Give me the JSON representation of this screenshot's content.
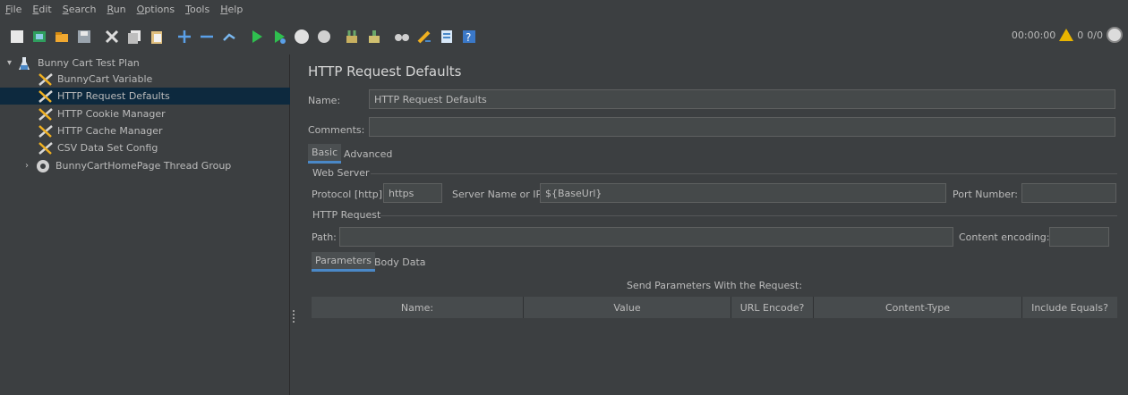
{
  "menu": [
    {
      "label": "File",
      "mnemonic": "F",
      "rest": "ile"
    },
    {
      "label": "Edit",
      "mnemonic": "E",
      "rest": "dit"
    },
    {
      "label": "Search",
      "mnemonic": "S",
      "rest": "earch"
    },
    {
      "label": "Run",
      "mnemonic": "R",
      "rest": "un"
    },
    {
      "label": "Options",
      "mnemonic": "O",
      "rest": "ptions"
    },
    {
      "label": "Tools",
      "mnemonic": "T",
      "rest": "ools"
    },
    {
      "label": "Help",
      "mnemonic": "H",
      "rest": "elp"
    }
  ],
  "toolbar": {
    "buttons": [
      "new-icon",
      "templates-icon",
      "open-icon",
      "save-icon",
      "cut-icon",
      "copy-icon",
      "paste-icon",
      "expand-icon",
      "collapse-icon",
      "toggle-icon",
      "start-icon",
      "start-no-pause-icon",
      "stop-icon",
      "shutdown-icon",
      "clear-icon",
      "clear-all-icon",
      "search-icon",
      "reset-search-icon",
      "function-helper-icon",
      "help-icon"
    ],
    "timer": "00:00:00",
    "warnings": "0",
    "threads": "0/0"
  },
  "tree": {
    "root": "Bunny Cart Test Plan",
    "items": [
      "BunnyCart Variable",
      "HTTP Request Defaults",
      "HTTP Cookie Manager",
      "HTTP Cache Manager",
      "CSV Data Set Config"
    ],
    "thread_group": "BunnyCartHomePage Thread Group",
    "selected": "HTTP Request Defaults"
  },
  "panel": {
    "title": "HTTP Request Defaults",
    "name_label": "Name:",
    "name_value": "HTTP Request Defaults",
    "comments_label": "Comments:",
    "comments_value": "",
    "tabs": [
      "Basic",
      "Advanced"
    ],
    "web_server_title": "Web Server",
    "protocol_label": "Protocol [http]:",
    "protocol_value": "https",
    "server_label": "Server Name or IP:",
    "server_value": "${BaseUrl}",
    "port_label": "Port Number:",
    "port_value": "",
    "http_request_title": "HTTP Request",
    "path_label": "Path:",
    "path_value": "",
    "encoding_label": "Content encoding:",
    "encoding_value": "",
    "sub_tabs": [
      "Parameters",
      "Body Data"
    ],
    "params_caption": "Send Parameters With the Request:",
    "columns": [
      "Name:",
      "Value",
      "URL Encode?",
      "Content-Type",
      "Include Equals?"
    ]
  },
  "colors": {
    "selection": "#0d293e",
    "accent": "#4a88c7",
    "background": "#3c3f41"
  }
}
